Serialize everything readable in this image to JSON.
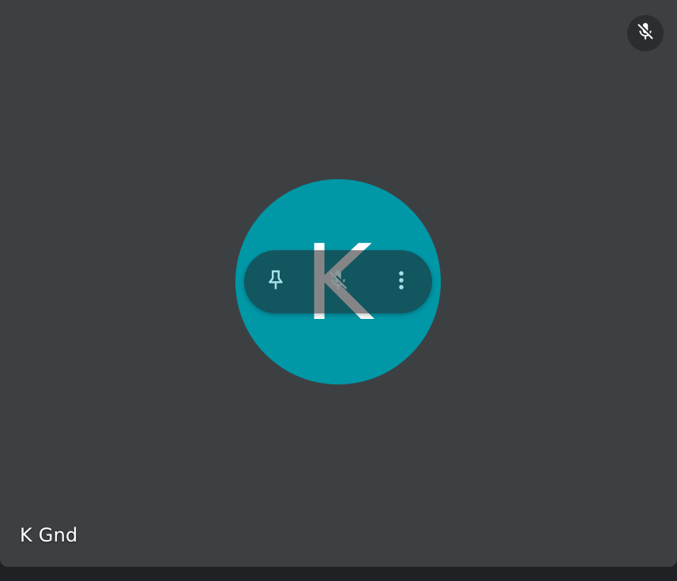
{
  "participant": {
    "name": "K Gnd",
    "initial": "K",
    "avatar_color": "#0097a7",
    "muted": true
  },
  "icons": {
    "mute_badge": "mic-off-icon",
    "pin": "pin-icon",
    "mic_toggle": "mic-off-icon",
    "more": "more-vert-icon"
  },
  "colors": {
    "tile_background": "#3c4043",
    "page_background": "#202124",
    "icon_light": "#ffffff",
    "icon_teal": "#a6e1e8"
  }
}
